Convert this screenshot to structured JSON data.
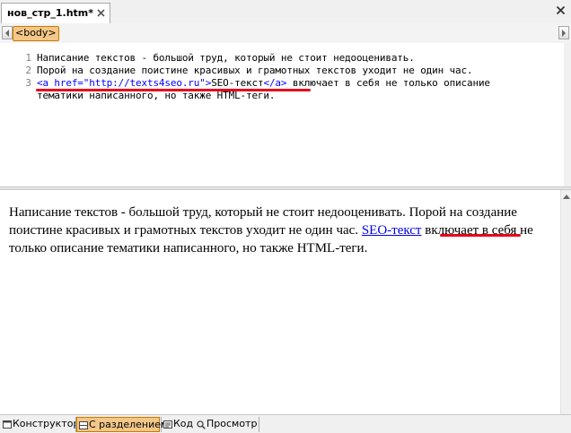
{
  "tab": {
    "title": "нов_стр_1.htm*"
  },
  "tag_selector": {
    "current_tag": "<body>"
  },
  "code": {
    "lines": [
      {
        "number": "1",
        "text": "Написание текстов - большой труд, который не стоит недооценивать."
      },
      {
        "number": "2",
        "text": "Порой на создание поистине красивых и грамотных текстов уходит не один час."
      },
      {
        "number": "3",
        "open_tag_start": "<a href=",
        "href_value": "\"http://texts4seo.ru\"",
        "open_tag_end": ">",
        "link_text": "SEO-текст",
        "close_tag": "</a>",
        "rest": " включает в себя не только описание"
      },
      {
        "number": "",
        "text": "тематики написанного, но также HTML-теги."
      }
    ]
  },
  "design": {
    "text_before": "Написание текстов - большой труд, который не стоит недооценивать. Порой на создание поистине красивых и грамотных текстов уходит не один час. ",
    "link_text": "SEO-текст",
    "text_after": " включает в себя не только описание тематики написанного, но также HTML-теги."
  },
  "view_tabs": [
    {
      "label": "Конструктор",
      "icon": "design-view-icon",
      "active": false
    },
    {
      "label": "С разделением",
      "icon": "split-view-icon",
      "active": true
    },
    {
      "label": "Код",
      "icon": "code-view-icon",
      "active": false
    },
    {
      "label": "Просмотр",
      "icon": "preview-view-icon",
      "active": false
    }
  ],
  "colors": {
    "accent": "#f3c788",
    "accent_border": "#c77a00",
    "highlight_underline": "#e8001a",
    "tag_blue": "#0000ff"
  }
}
